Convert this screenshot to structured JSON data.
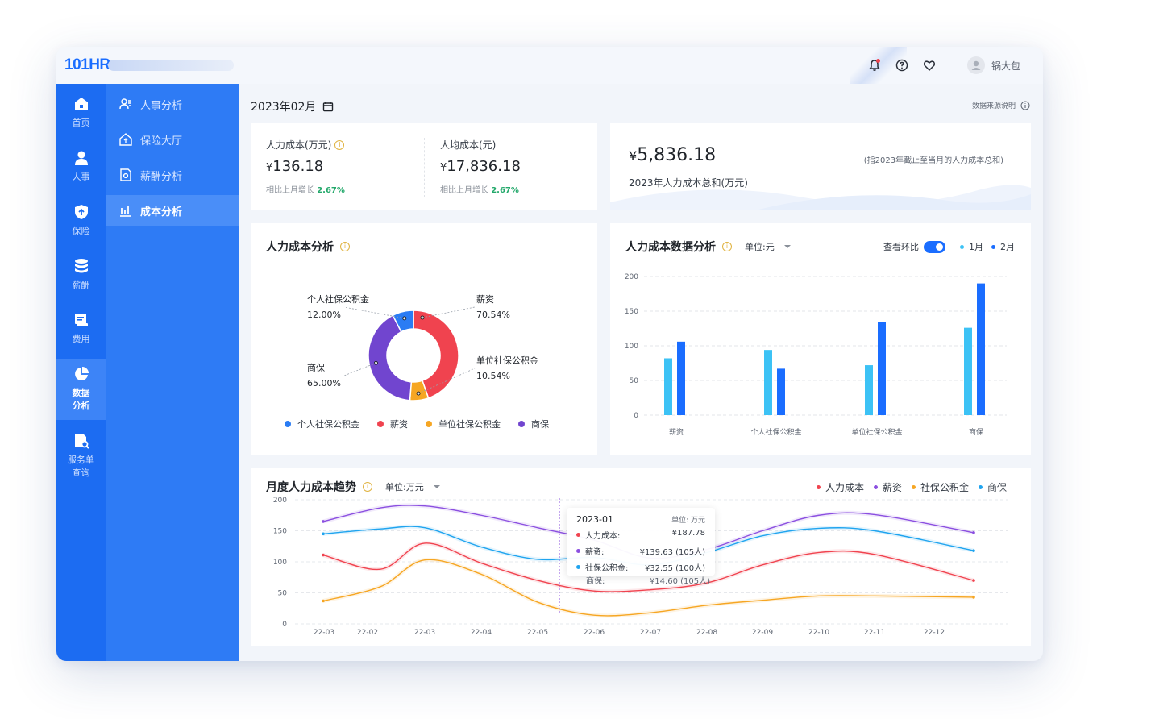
{
  "app": {
    "logo": "101HR",
    "username": "锅大包"
  },
  "rail": [
    {
      "label": "首页",
      "icon": "home-icon"
    },
    {
      "label": "人事",
      "icon": "person-icon"
    },
    {
      "label": "保险",
      "icon": "shield-icon"
    },
    {
      "label": "薪酬",
      "icon": "coins-icon"
    },
    {
      "label": "费用",
      "icon": "receipt-icon"
    },
    {
      "label": "数据\n分析",
      "label1": "数据",
      "label2": "分析",
      "icon": "pie-chart-icon",
      "active": true
    },
    {
      "label1": "服务单",
      "label2": "查询",
      "icon": "search-doc-icon"
    }
  ],
  "subnav": [
    {
      "label": "人事分析",
      "icon": "people-icon"
    },
    {
      "label": "保险大厅",
      "icon": "house-icon"
    },
    {
      "label": "薪酬分析",
      "icon": "doc-gear-icon"
    },
    {
      "label": "成本分析",
      "icon": "bar-chart-icon",
      "active": true
    }
  ],
  "header": {
    "date": "2023年02月",
    "source_note": "数据来源说明"
  },
  "stats": {
    "labor_cost": {
      "label": "人力成本(万元)",
      "currency": "¥",
      "value": "136.18",
      "sub_prefix": "相比上月增长",
      "growth": "2.67%"
    },
    "avg_cost": {
      "label": "人均成本(元)",
      "currency": "¥",
      "value": "17,836.18",
      "sub_prefix": "相比上月增长",
      "growth": "2.67%"
    },
    "total": {
      "currency": "¥",
      "value": "5,836.18",
      "label": "2023年人力成本总和(万元)",
      "note": "(指2023年截止至当月的人力成本总和)"
    }
  },
  "donut_card": {
    "title": "人力成本分析"
  },
  "bar_card": {
    "title": "人力成本数据分析",
    "unit": "单位:元",
    "toggle_label": "查看环比"
  },
  "trend_card": {
    "title": "月度人力成本趋势",
    "unit": "单位:万元"
  },
  "tooltip": {
    "title": "2023-01",
    "unit": "单位: 万元",
    "rows": [
      {
        "label": "人力成本:",
        "value": "¥187.78",
        "color": "#f0434f"
      },
      {
        "label": "薪资:",
        "value": "¥139.63 (105人)",
        "color": "#8b4fe0"
      },
      {
        "label": "社保公积金:",
        "value": "¥32.55 (100人)",
        "color": "#f6a623"
      },
      {
        "label": "商保:",
        "value": "¥14.60 (105人)",
        "color": "#1fa4ef"
      }
    ]
  },
  "chart_data": [
    {
      "type": "pie",
      "title": "人力成本分析",
      "labels": [
        "薪资",
        "单位社保公积金",
        "商保",
        "个人社保公积金"
      ],
      "values": [
        70.54,
        10.54,
        65.0,
        12.0
      ],
      "value_labels": [
        "70.54%",
        "10.54%",
        "65.00%",
        "12.00%"
      ],
      "colors": [
        "#f0434f",
        "#f6a623",
        "#7145cf",
        "#2a7cf4"
      ],
      "legend": [
        "个人社保公积金",
        "薪资",
        "单位社保公积金",
        "商保"
      ],
      "legend_colors": [
        "#2a7cf4",
        "#f0434f",
        "#f6a623",
        "#7145cf"
      ],
      "legend_placement": "bottom"
    },
    {
      "type": "bar",
      "title": "人力成本数据分析",
      "categories": [
        "薪资",
        "个人社保公积金",
        "单位社保公积金",
        "商保"
      ],
      "series": [
        {
          "name": "1月",
          "values": [
            82,
            94,
            72,
            126
          ],
          "color": "#3cc2f5"
        },
        {
          "name": "2月",
          "values": [
            106,
            67,
            134,
            190
          ],
          "color": "#1a6dff"
        }
      ],
      "yticks": [
        0,
        50,
        100,
        150,
        200
      ],
      "ylim": [
        0,
        200
      ],
      "legend_placement": "top-right",
      "grid": true
    },
    {
      "type": "line",
      "title": "月度人力成本趋势",
      "x": [
        "22-03",
        "22-02",
        "22-03",
        "22-04",
        "22-05",
        "22-06",
        "22-07",
        "22-08",
        "22-09",
        "22-10",
        "22-11",
        "22-12"
      ],
      "series": [
        {
          "name": "人力成本",
          "color": "#f0434f",
          "values": [
            111,
            88,
            130,
            98,
            70,
            53,
            55,
            66,
            95,
            115,
            112,
            70
          ]
        },
        {
          "name": "薪资",
          "color": "#8b4fe0",
          "values": [
            165,
            187,
            190,
            175,
            155,
            135,
            106,
            120,
            150,
            175,
            176,
            147
          ]
        },
        {
          "name": "社保公积金",
          "color": "#f6a623",
          "values": [
            37,
            60,
            103,
            80,
            35,
            14,
            18,
            30,
            38,
            45,
            45,
            43
          ]
        },
        {
          "name": "商保",
          "color": "#1fa4ef",
          "values": [
            145,
            153,
            155,
            124,
            104,
            107,
            95,
            115,
            142,
            154,
            150,
            118
          ]
        }
      ],
      "yticks": [
        0,
        50,
        100,
        150,
        200
      ],
      "ylim": [
        0,
        200
      ],
      "legend_placement": "top-right",
      "grid": true
    }
  ]
}
